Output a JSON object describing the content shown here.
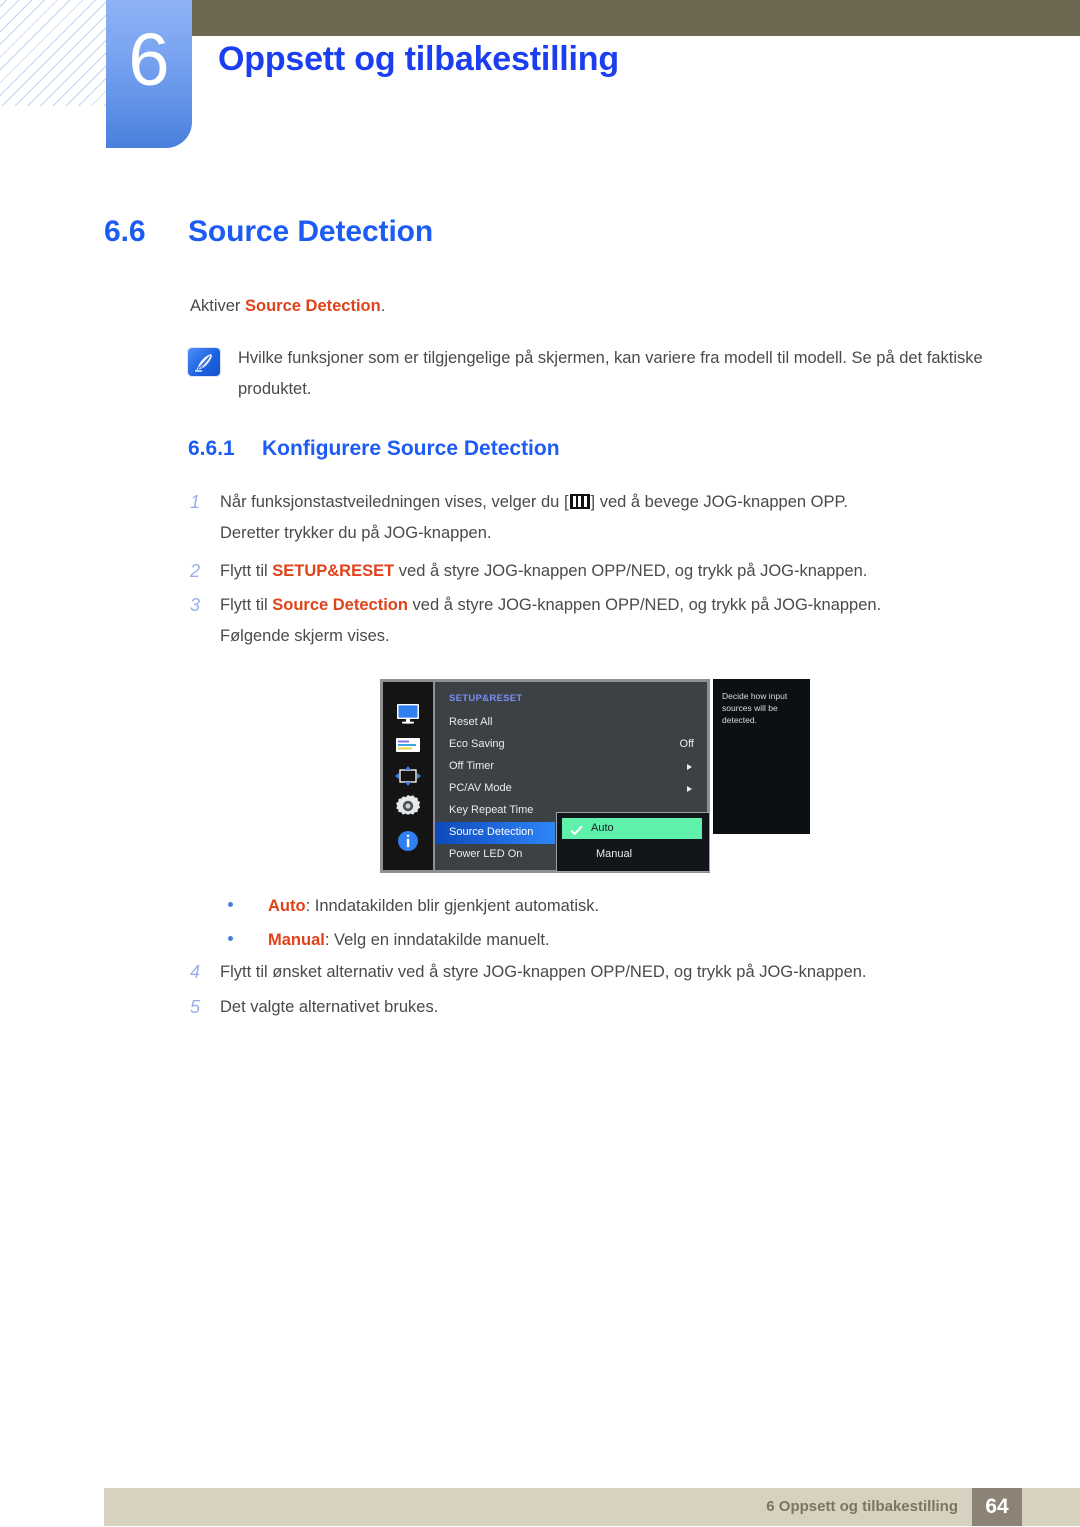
{
  "header": {
    "chapter_number": "6",
    "chapter_title": "Oppsett og tilbakestilling"
  },
  "section": {
    "number": "6.6",
    "title": "Source Detection",
    "lead_prefix": "Aktiver ",
    "lead_term": "Source Detection",
    "lead_suffix": "."
  },
  "note": {
    "icon": "note-quill-icon",
    "text": "Hvilke funksjoner som er tilgjengelige på skjermen, kan variere fra modell til modell. Se på det faktiske produktet."
  },
  "subsection": {
    "number": "6.6.1",
    "title": "Konfigurere Source Detection"
  },
  "steps": [
    {
      "n": "1",
      "part1": "Når funksjonstastveiledningen vises, velger du [",
      "glyph": "menu-icon",
      "part2": "] ved å bevege JOG-knappen OPP.",
      "line2": "Deretter trykker du på JOG-knappen."
    },
    {
      "n": "2",
      "part1": "Flytt til ",
      "term": "SETUP&RESET",
      "part2": " ved å styre JOG-knappen OPP/NED, og trykk på JOG-knappen."
    },
    {
      "n": "3",
      "part1": "Flytt til ",
      "term": "Source Detection",
      "part2": " ved å styre JOG-knappen OPP/NED, og trykk på JOG-knappen.",
      "line2": "Følgende skjerm vises."
    },
    {
      "n": "4",
      "part1": "Flytt til ønsket alternativ ved å styre JOG-knappen OPP/NED, og trykk på JOG-knappen."
    },
    {
      "n": "5",
      "part1": "Det valgte alternativet brukes."
    }
  ],
  "bullets": [
    {
      "term": "Auto",
      "text": ": Inndatakilden blir gjenkjent automatisk."
    },
    {
      "term": "Manual",
      "text": ": Velg en inndatakilde manuelt."
    }
  ],
  "osd": {
    "title": "SETUP&RESET",
    "sidebar_icons": [
      "monitor-icon",
      "picture-settings-icon",
      "screen-adjust-icon",
      "setup-gear-icon",
      "information-icon"
    ],
    "rows": [
      {
        "label": "Reset All",
        "value": "",
        "arrow": false,
        "selected": false
      },
      {
        "label": "Eco Saving",
        "value": "Off",
        "arrow": false,
        "selected": false
      },
      {
        "label": "Off Timer",
        "value": "",
        "arrow": true,
        "selected": false
      },
      {
        "label": "PC/AV Mode",
        "value": "",
        "arrow": true,
        "selected": false
      },
      {
        "label": "Key Repeat Time",
        "value": "",
        "arrow": false,
        "selected": false
      },
      {
        "label": "Source Detection",
        "value": "",
        "arrow": false,
        "selected": true
      },
      {
        "label": "Power LED On",
        "value": "",
        "arrow": false,
        "selected": false
      }
    ],
    "submenu": [
      {
        "label": "Auto",
        "checked": true
      },
      {
        "label": "Manual",
        "checked": false
      }
    ],
    "tooltip": "Decide how input sources will be detected."
  },
  "footer": {
    "text": "6 Oppsett og tilbakestilling",
    "page": "64"
  },
  "colors": {
    "chapter_title": "#1b3ff0",
    "heading": "#1c5cf5",
    "highlight_term": "#e0421a",
    "step_number": "#9aaeea",
    "olive_bar": "#6c6852",
    "footer_bar": "#d7d2bf",
    "page_box": "#8c8275",
    "osd_select": "#2f86f5",
    "osd_option_on": "#5ff0ab"
  }
}
